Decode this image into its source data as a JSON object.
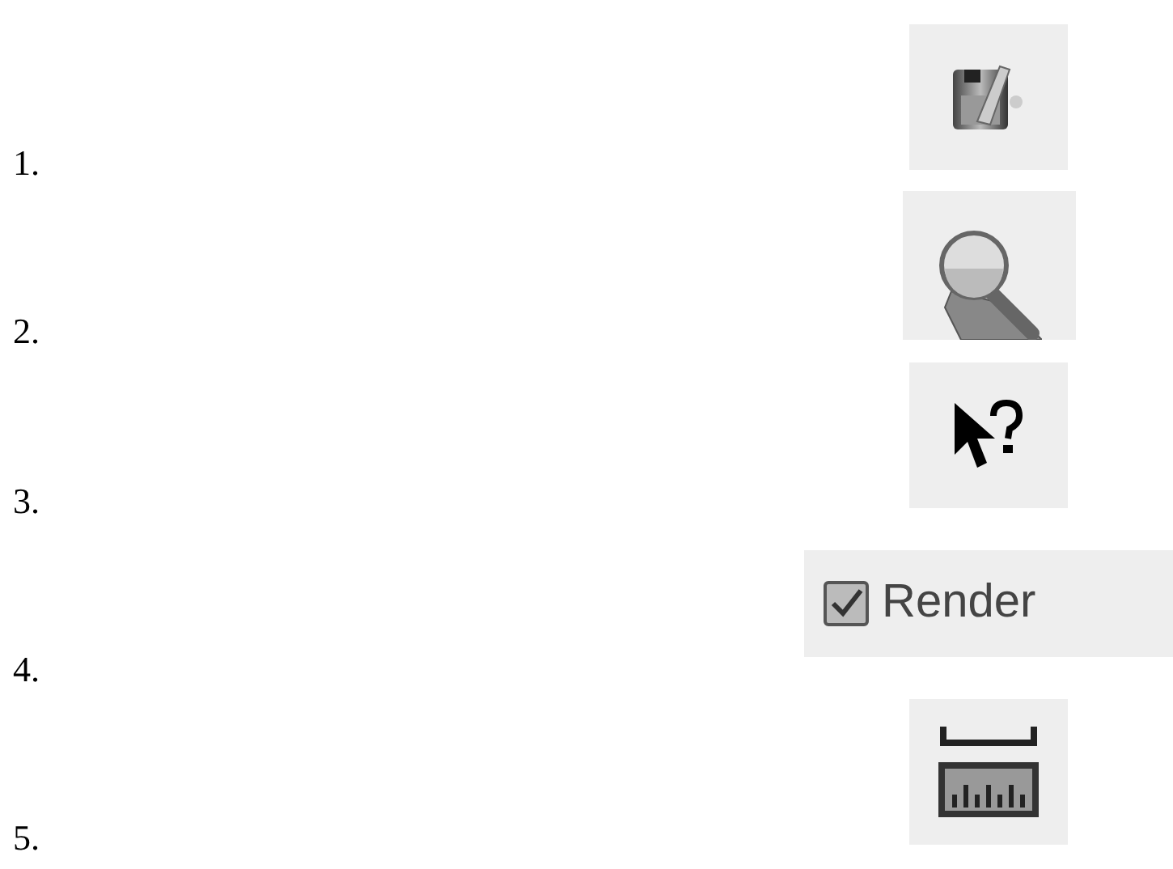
{
  "items": [
    {
      "number": "1.",
      "kind": "save"
    },
    {
      "number": "2.",
      "kind": "zoom"
    },
    {
      "number": "3.",
      "kind": "help"
    },
    {
      "number": "4.",
      "kind": "checkbox",
      "label": "Render",
      "checked": true
    },
    {
      "number": "5.",
      "kind": "ruler"
    }
  ]
}
